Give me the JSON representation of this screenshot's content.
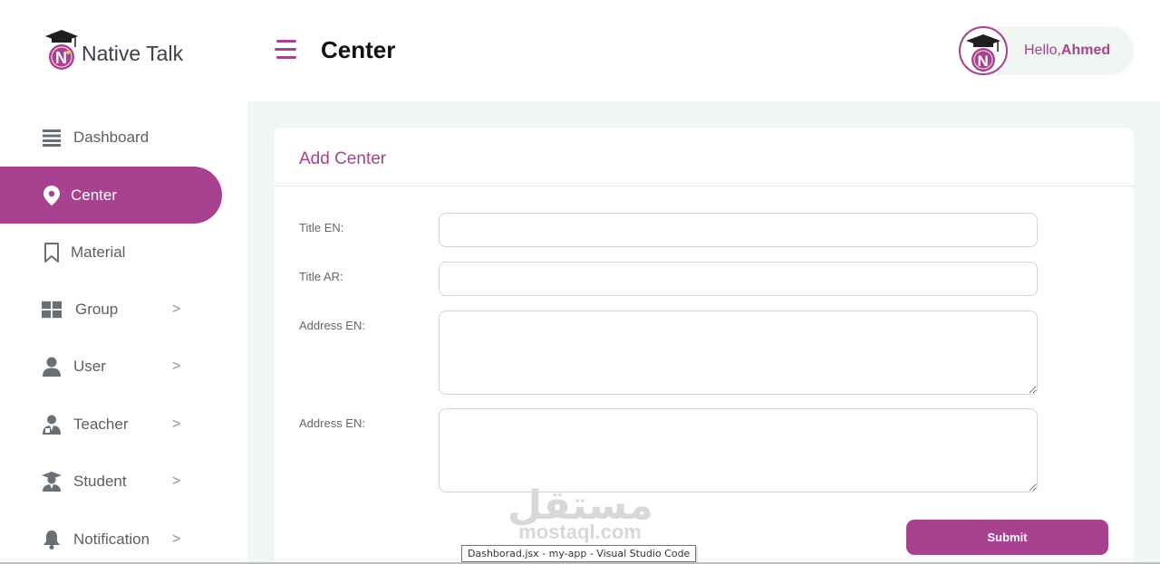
{
  "brand": {
    "name": "Native Talk",
    "accent": "#a8418f"
  },
  "sidebar": {
    "items": [
      {
        "label": "Dashboard",
        "icon": "list-icon",
        "has_submenu": false,
        "active": false
      },
      {
        "label": "Center",
        "icon": "map-pin-icon",
        "has_submenu": false,
        "active": true
      },
      {
        "label": "Material",
        "icon": "bookmark-icon",
        "has_submenu": false,
        "active": false
      },
      {
        "label": "Group",
        "icon": "grid-icon",
        "has_submenu": true,
        "active": false
      },
      {
        "label": "User",
        "icon": "user-icon",
        "has_submenu": true,
        "active": false
      },
      {
        "label": "Teacher",
        "icon": "teacher-icon",
        "has_submenu": true,
        "active": false
      },
      {
        "label": "Student",
        "icon": "graduate-icon",
        "has_submenu": true,
        "active": false
      },
      {
        "label": "Notification",
        "icon": "bell-icon",
        "has_submenu": true,
        "active": false
      }
    ],
    "chevron": ">"
  },
  "header": {
    "title": "Center",
    "greeting": "Hello,",
    "user_name": "Ahmed"
  },
  "form": {
    "title": "Add Center",
    "fields": [
      {
        "label": "Title EN:",
        "value": "",
        "type": "input"
      },
      {
        "label": "Title AR:",
        "value": "",
        "type": "input"
      },
      {
        "label": "Address EN:",
        "value": "",
        "type": "textarea"
      },
      {
        "label": "Address EN:",
        "value": "",
        "type": "textarea"
      }
    ],
    "submit_label": "Submit"
  },
  "watermark": {
    "arabic": "مستقل",
    "latin": "mostaql.com"
  },
  "tooltip": "Dashborad.jsx - my-app - Visual Studio Code"
}
